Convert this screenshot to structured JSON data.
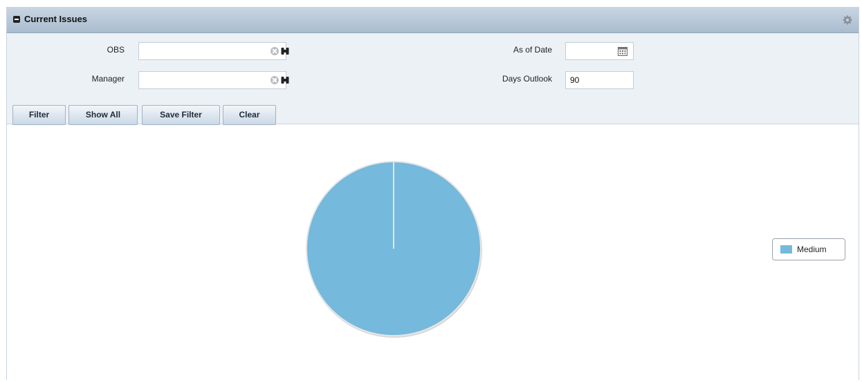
{
  "portlet": {
    "title": "Current Issues"
  },
  "filters": {
    "obs_label": "OBS",
    "obs_value": "",
    "manager_label": "Manager",
    "manager_value": "",
    "as_of_date_label": "As of Date",
    "as_of_date_value": "",
    "days_outlook_label": "Days Outlook",
    "days_outlook_value": "90"
  },
  "buttons": {
    "filter": "Filter",
    "show_all": "Show All",
    "save_filter": "Save Filter",
    "clear": "Clear"
  },
  "icons": {
    "collapse": "collapse-icon",
    "settings": "gear-icon",
    "clear_field": "clear-icon",
    "lookup": "binoculars-icon",
    "calendar": "calendar-icon"
  },
  "colors": {
    "header": "#b4c5d6",
    "filter_bg": "#ecf1f6",
    "slice_medium": "#75b9dc"
  },
  "chart_data": {
    "type": "pie",
    "categories": [
      "Medium"
    ],
    "values": [
      1
    ],
    "legend_position": "right"
  }
}
